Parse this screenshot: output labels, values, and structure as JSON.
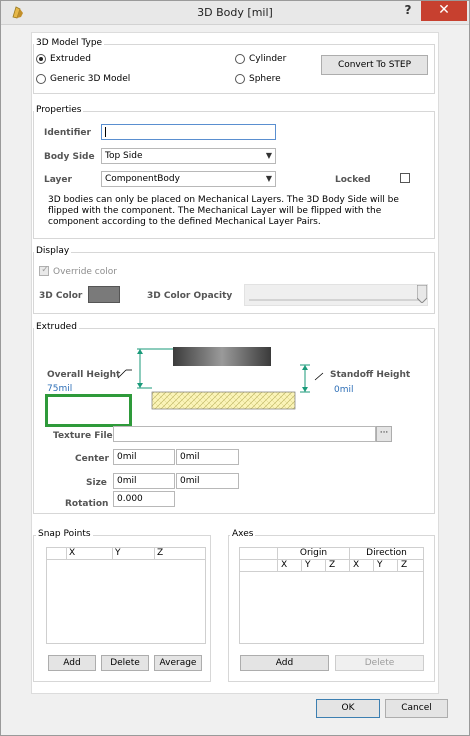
{
  "window": {
    "title": "3D Body [mil]",
    "help": "?",
    "close": "✕"
  },
  "model_type": {
    "label": "3D Model Type",
    "extruded": "Extruded",
    "cylinder": "Cylinder",
    "generic": "Generic 3D Model",
    "sphere": "Sphere",
    "convert_button": "Convert To STEP"
  },
  "properties": {
    "label": "Properties",
    "identifier_label": "Identifier",
    "identifier_value": "",
    "body_side_label": "Body Side",
    "body_side_value": "Top Side",
    "layer_label": "Layer",
    "layer_value": "ComponentBody",
    "locked_label": "Locked",
    "note_line1": "3D bodies can only be placed on Mechanical Layers. The 3D Body Side will be",
    "note_line2": "flipped with the component. The Mechanical Layer will be flipped with the",
    "note_line3": "component according to the defined Mechanical Layer Pairs."
  },
  "display": {
    "label": "Display",
    "override_label": "Override color",
    "color_label": "3D Color",
    "opacity_label": "3D Color Opacity",
    "color": "#7a7a7a"
  },
  "extruded": {
    "label": "Extruded",
    "overall_height_label": "Overall Height",
    "overall_height_value": "75mil",
    "standoff_label": "Standoff Height",
    "standoff_value": "0mil",
    "texture_label": "Texture File",
    "texture_value": "",
    "browse": "···",
    "center_label": "Center",
    "center_x": "0mil",
    "center_y": "0mil",
    "size_label": "Size",
    "size_x": "0mil",
    "size_y": "0mil",
    "rotation_label": "Rotation",
    "rotation_value": "0.000"
  },
  "snap_points": {
    "label": "Snap Points",
    "columns": [
      "X",
      "Y",
      "Z"
    ],
    "add": "Add",
    "delete": "Delete",
    "average": "Average"
  },
  "axes": {
    "label": "Axes",
    "origin": "Origin",
    "direction": "Direction",
    "columns": [
      "X",
      "Y",
      "Z",
      "X",
      "Y",
      "Z"
    ],
    "add": "Add",
    "delete": "Delete"
  },
  "footer": {
    "ok": "OK",
    "cancel": "Cancel"
  },
  "colors": {
    "highlight": "#2e9a3a",
    "close_bg": "#c7402f",
    "accent": "#2e6fb7",
    "arrow": "#1a9a7a"
  }
}
